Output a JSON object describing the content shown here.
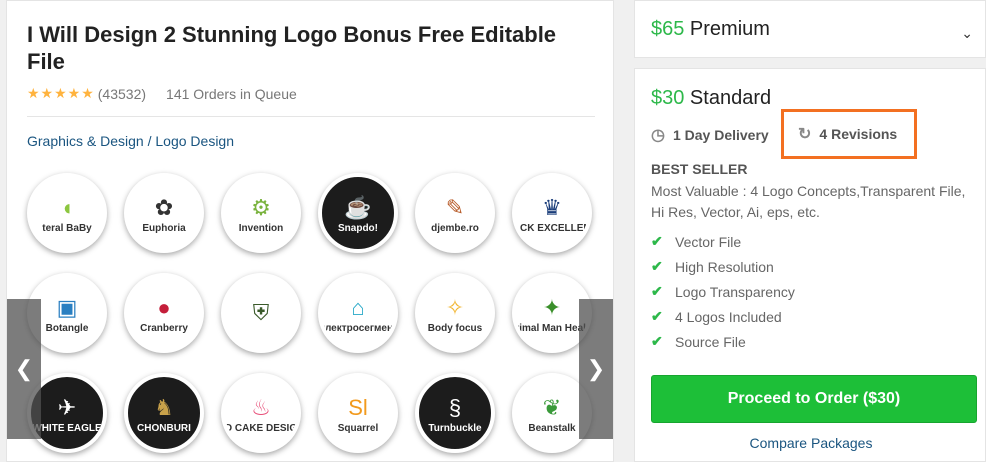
{
  "gig": {
    "title": "I Will Design 2 Stunning Logo Bonus Free Editable File",
    "stars": "★★★★★",
    "reviews": "(43532)",
    "queue": "141 Orders in Queue",
    "breadcrumb": "Graphics & Design / Logo Design"
  },
  "gallery": {
    "prev_icon": "chevron-left-icon",
    "next_icon": "chevron-right-icon",
    "logos": [
      {
        "name": "teral BaBy",
        "mark": "◖",
        "color": "#8cc63f",
        "dark": false
      },
      {
        "name": "Euphoria",
        "mark": "✿",
        "color": "#333333",
        "dark": false
      },
      {
        "name": "Invention",
        "mark": "⚙",
        "color": "#7ab33e",
        "dark": false
      },
      {
        "name": "Snapdo!",
        "mark": "☕",
        "color": "#e94e1b",
        "dark": true
      },
      {
        "name": "djembe.ro",
        "mark": "✎",
        "color": "#b85c2a",
        "dark": false
      },
      {
        "name": "BLACK EXCELLENCE",
        "mark": "♛",
        "color": "#1a3d7a",
        "dark": false
      },
      {
        "name": "Botangle",
        "mark": "▣",
        "color": "#2a7fc1",
        "dark": false
      },
      {
        "name": "Cranberry",
        "mark": "●",
        "color": "#c41e3a",
        "dark": false
      },
      {
        "name": "",
        "mark": "⛨",
        "color": "#3a5a2a",
        "dark": false
      },
      {
        "name": "Электросегмент",
        "mark": "⌂",
        "color": "#28a9c8",
        "dark": false
      },
      {
        "name": "Body focus",
        "mark": "✧",
        "color": "#f2b632",
        "dark": false
      },
      {
        "name": "Primal Man Health",
        "mark": "✦",
        "color": "#3a8f2a",
        "dark": false
      },
      {
        "name": "WHITE EAGLE",
        "mark": "✈",
        "color": "#ffffff",
        "dark": true
      },
      {
        "name": "CHONBURI",
        "mark": "♞",
        "color": "#c9a24a",
        "dark": true
      },
      {
        "name": "AD CAKE DESIGN",
        "mark": "♨",
        "color": "#e8507a",
        "dark": false
      },
      {
        "name": "Squarrel",
        "mark": "Sl",
        "color": "#f29a1d",
        "dark": false
      },
      {
        "name": "Turnbuckle",
        "mark": "§",
        "color": "#ffffff",
        "dark": true
      },
      {
        "name": "Beanstalk",
        "mark": "❦",
        "color": "#3a9a3a",
        "dark": false
      }
    ]
  },
  "premium": {
    "amount": "$65",
    "label": " Premium",
    "chevron": "chevron-down-icon"
  },
  "standard": {
    "amount": "$30",
    "label": " Standard",
    "delivery": "1 Day Delivery",
    "revisions": "4 Revisions",
    "badge": "BEST SELLER",
    "description": "Most Valuable : 4 Logo Concepts,Transparent File, Hi Res, Vector, Ai, eps, etc.",
    "features": [
      "Vector File",
      "High Resolution",
      "Logo Transparency",
      "4 Logos Included",
      "Source File"
    ],
    "order_label": "Proceed to Order ($30)",
    "compare_label": "Compare Packages"
  },
  "colors": {
    "accent_green": "#1dbf38",
    "price_green": "#2db84a",
    "highlight_orange": "#f37021",
    "link_blue": "#1a5580"
  }
}
